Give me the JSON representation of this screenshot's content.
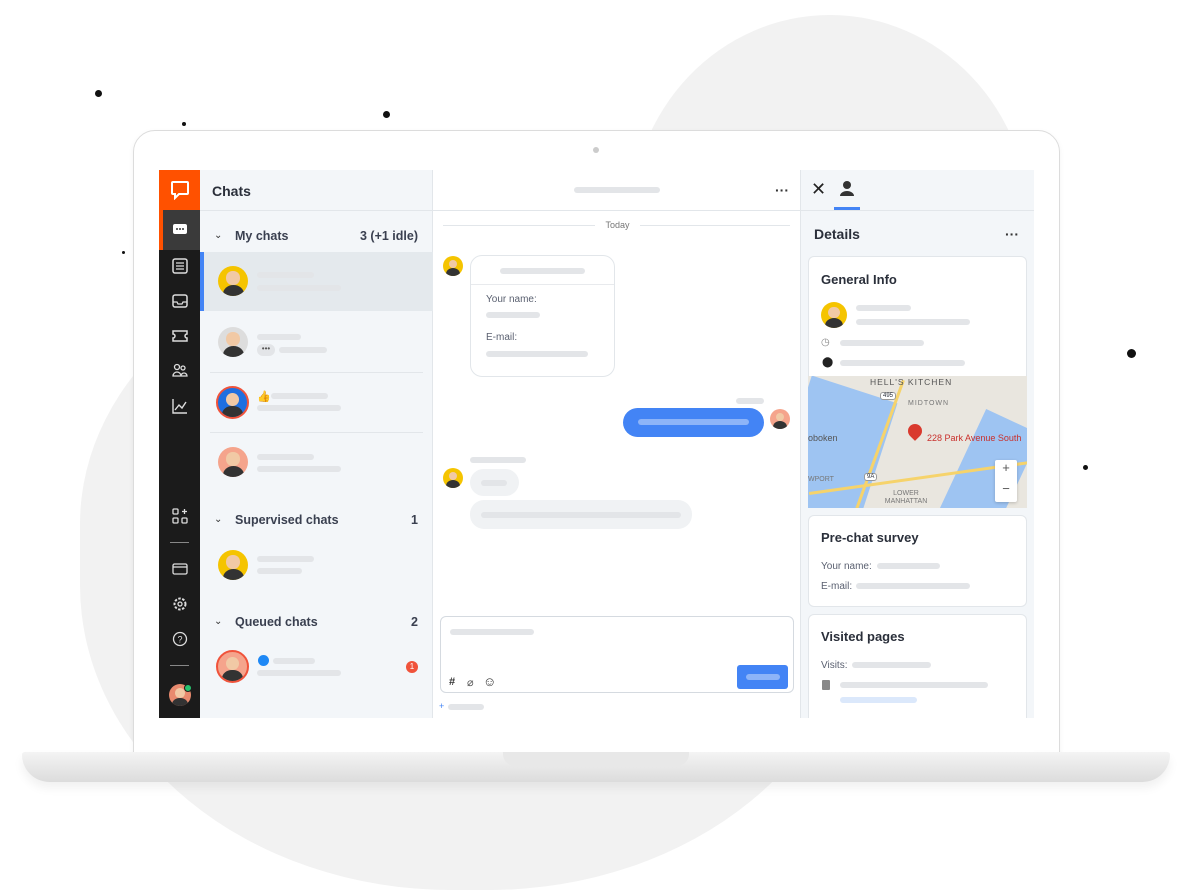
{
  "sidebar": {
    "icons": [
      "livechat-logo-icon",
      "chats-icon",
      "list-icon",
      "inbox-icon",
      "ticket-icon",
      "customers-icon",
      "reports-icon",
      "apps-icon",
      "billing-icon",
      "settings-icon",
      "help-icon",
      "agent-avatar"
    ]
  },
  "chats": {
    "title": "Chats",
    "sections": [
      {
        "label": "My chats",
        "count": "3 (+1 idle)"
      },
      {
        "label": "Supervised chats",
        "count": "1"
      },
      {
        "label": "Queued chats",
        "count": "2"
      }
    ],
    "queued_badge": "1"
  },
  "conversation": {
    "day_label": "Today",
    "form": {
      "name_label": "Your name:",
      "email_label": "E-mail:"
    }
  },
  "details": {
    "title": "Details",
    "general_info": "General Info",
    "map_address": "228 Park Avenue South",
    "map_labels": [
      "HELL'S KITCHEN",
      "MIDTOWN",
      "oboken",
      "LOWER MANHATTAN",
      "WPORT",
      "495",
      "9A"
    ],
    "zoom_in": "+",
    "zoom_out": "−",
    "prechat": {
      "title": "Pre-chat survey",
      "name_label": "Your name:",
      "email_label": "E-mail:"
    },
    "visited": {
      "title": "Visited pages",
      "visits_label": "Visits:"
    }
  },
  "colors": {
    "brand": "#ff5100",
    "accent": "#4384f5",
    "sidebar": "#1b1b1b"
  }
}
